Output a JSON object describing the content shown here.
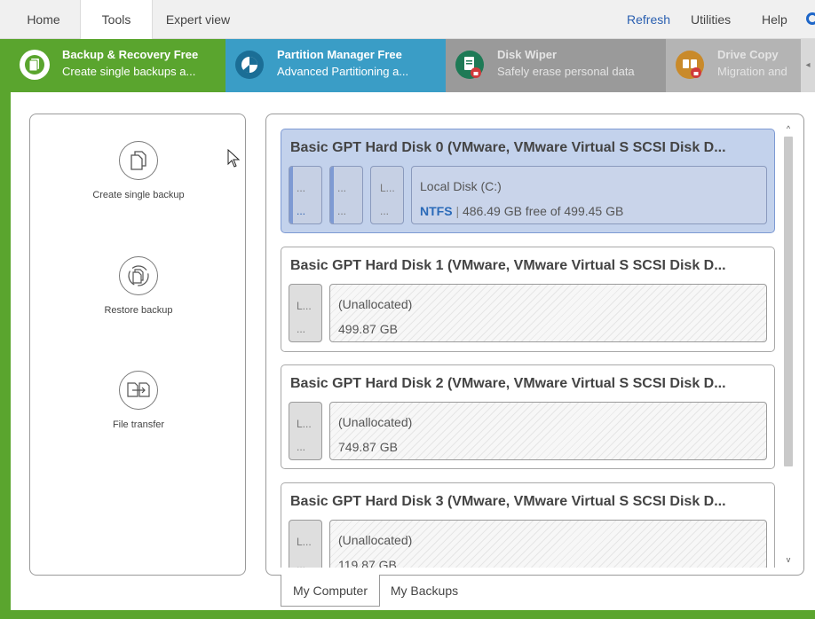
{
  "menu": {
    "tabs": [
      {
        "label": "Home"
      },
      {
        "label": "Tools"
      },
      {
        "label": "Expert view"
      }
    ],
    "right": [
      {
        "label": "Refresh"
      },
      {
        "label": "Utilities"
      },
      {
        "label": "Help"
      }
    ]
  },
  "apps": [
    {
      "title": "Backup & Recovery Free",
      "subtitle": "Create single backups a...",
      "icon": "backup-icon",
      "color": "#5aa52e"
    },
    {
      "title": "Partition Manager Free",
      "subtitle": "Advanced Partitioning a...",
      "icon": "pie-chart-icon",
      "color": "#3a9dc6"
    },
    {
      "title": "Disk Wiper",
      "subtitle": "Safely erase personal data",
      "icon": "document-lock-icon",
      "color": "#9a9a9a"
    },
    {
      "title": "Drive Copy",
      "subtitle": "Migration and",
      "icon": "drive-copy-lock-icon",
      "color": "#b4b4b4"
    }
  ],
  "actions": [
    {
      "label": "Create single backup",
      "icon": "document-copy-icon"
    },
    {
      "label": "Restore backup",
      "icon": "restore-icon"
    },
    {
      "label": "File transfer",
      "icon": "file-transfer-icon"
    }
  ],
  "disks": [
    {
      "title": "Basic GPT Hard Disk 0 (VMware, VMware Virtual S SCSI Disk D...",
      "selected": true,
      "small_parts": [
        {
          "line1": "...",
          "line2": "..."
        },
        {
          "line1": "...",
          "line2": "..."
        },
        {
          "line1": "L...",
          "line2": "..."
        }
      ],
      "main_part": {
        "name": "Local Disk (C:)",
        "fs": "NTFS",
        "sep": "|",
        "info": "486.49 GB free of 499.45 GB"
      }
    },
    {
      "title": "Basic GPT Hard Disk 1 (VMware, VMware Virtual S SCSI Disk D...",
      "small_parts": [
        {
          "line1": "L...",
          "line2": "..."
        }
      ],
      "main_part": {
        "name": "(Unallocated)",
        "size": "499.87 GB"
      }
    },
    {
      "title": "Basic GPT Hard Disk 2 (VMware, VMware Virtual S SCSI Disk D...",
      "small_parts": [
        {
          "line1": "L...",
          "line2": "..."
        }
      ],
      "main_part": {
        "name": "(Unallocated)",
        "size": "749.87 GB"
      }
    },
    {
      "title": "Basic GPT Hard Disk 3 (VMware, VMware Virtual S SCSI Disk D...",
      "small_parts": [
        {
          "line1": "L...",
          "line2": "..."
        }
      ],
      "main_part": {
        "name": "(Unallocated)",
        "size": "119.87 GB"
      }
    }
  ],
  "bottom_tabs": [
    {
      "label": "My Computer"
    },
    {
      "label": "My Backups"
    }
  ],
  "scroll": {
    "up": "^",
    "down": "v"
  },
  "colors": {
    "accent_green": "#5aa52e",
    "link_blue": "#2a5fb0",
    "selected_disk": "#c3d2ec"
  }
}
